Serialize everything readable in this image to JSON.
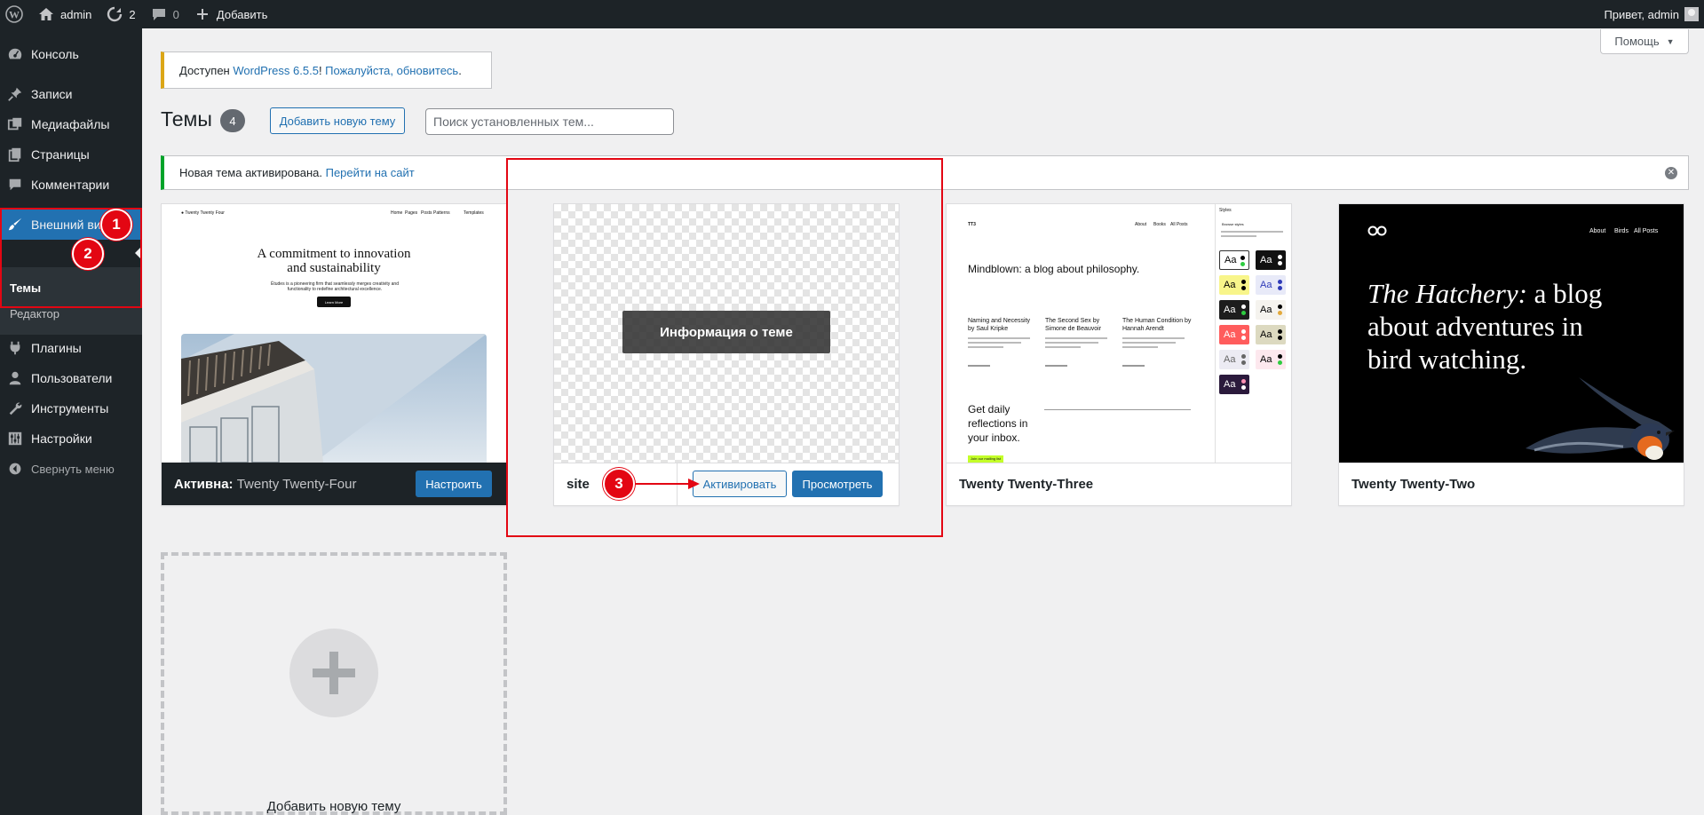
{
  "admin_bar": {
    "site_name": "admin",
    "updates_count": "2",
    "comments_count": "0",
    "new_label": "Добавить",
    "greeting": "Привет, admin"
  },
  "sidebar": {
    "items": [
      {
        "label": "Консоль",
        "icon": "dashboard-icon"
      },
      {
        "label": "Записи",
        "icon": "pin-icon"
      },
      {
        "label": "Медиафайлы",
        "icon": "media-icon"
      },
      {
        "label": "Страницы",
        "icon": "pages-icon"
      },
      {
        "label": "Комментарии",
        "icon": "comments-icon"
      },
      {
        "label": "Внешний вид",
        "icon": "appearance-brush-icon"
      },
      {
        "label": "Плагины",
        "icon": "plugins-icon"
      },
      {
        "label": "Пользователи",
        "icon": "users-icon"
      },
      {
        "label": "Инструменты",
        "icon": "tools-wrench-icon"
      },
      {
        "label": "Настройки",
        "icon": "settings-icon"
      }
    ],
    "submenu": [
      {
        "label": "Темы"
      },
      {
        "label": "Редактор"
      }
    ],
    "collapse_label": "Свернуть меню"
  },
  "help_label": "Помощь",
  "update_notice": {
    "prefix": "Доступен ",
    "version_link": "WordPress 6.5.5",
    "middle": "! ",
    "update_link": "Пожалуйста, обновитесь",
    "suffix": "."
  },
  "page": {
    "title": "Темы",
    "theme_count": "4",
    "add_new_label": "Добавить новую тему",
    "search_placeholder": "Поиск установленных тем..."
  },
  "activated_notice": {
    "text": "Новая тема активирована. ",
    "link": "Перейти на сайт"
  },
  "themes": [
    {
      "name": "Twenty Twenty-Four",
      "active_prefix": "Активна:",
      "customize_label": "Настроить",
      "preview": {
        "site_title": "Twenty Twenty Four",
        "nav": [
          "Home",
          "Pages",
          "Posts",
          "Patterns",
          "Templates"
        ],
        "heading": "A commitment to innovation and sustainability",
        "subtext": "Études is a pioneering firm that seamlessly merges creativity and functionality to redefine architectural excellence.",
        "button": "Learn More"
      }
    },
    {
      "name": "site",
      "details_label": "Информация о теме",
      "activate_label": "Активировать",
      "preview_label": "Просмотреть"
    },
    {
      "name": "Twenty Twenty-Three",
      "preview": {
        "logo": "TT3",
        "nav": [
          "About",
          "Books",
          "All Posts"
        ],
        "headline": "Mindblown: a blog about philosophy.",
        "posts": [
          "Naming and Necessity by Saul Kripke",
          "The Second Sex by Simone de Beauvoir",
          "The Human Condition by Hannah Arendt"
        ],
        "cta": "Get daily reflections in your inbox.",
        "cta_button": "Join our mailing list",
        "panel_title": "Styles",
        "panel_sub": "Browse styles",
        "swatch_label": "Aa"
      }
    },
    {
      "name": "Twenty Twenty-Two",
      "preview": {
        "nav": [
          "About",
          "Birds",
          "All Posts"
        ],
        "headline_italic": "The Hatchery:",
        "headline_rest": " a blog about adventures in bird watching."
      }
    }
  ],
  "add_new_theme_label": "Добавить новую тему",
  "annotations": [
    "1",
    "2",
    "3"
  ],
  "colors": {
    "admin_dark": "#1d2327",
    "accent_blue": "#2271b1",
    "annotation_red": "#e30613",
    "success_green": "#00a32a",
    "warning_yellow": "#dba617"
  }
}
